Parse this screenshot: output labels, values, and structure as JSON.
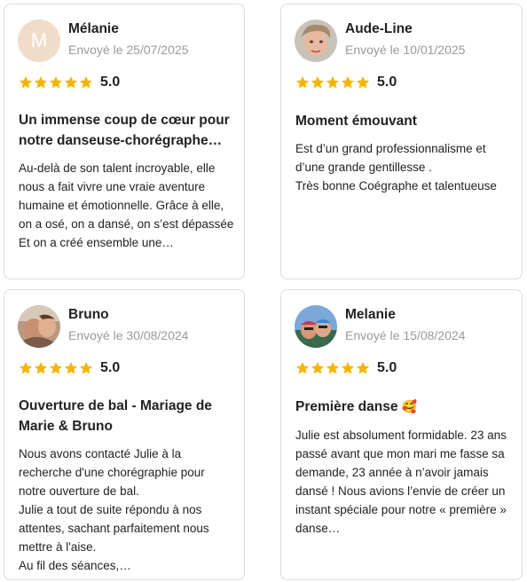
{
  "colors": {
    "star": "#f5b400",
    "border": "#dcdcdc",
    "muted": "#9a9a9a"
  },
  "reviews": [
    {
      "name": "Mélanie",
      "date": "Envoyé le 25/07/2025",
      "avatar_initial": "M",
      "stars": 5,
      "score": "5.0",
      "title": "Un immense coup de cœur pour notre danseuse-chorégraphe…",
      "text": "Au-delà de son talent incroyable, elle nous a fait vivre une vraie aventure humaine et émotionnelle. Grâce à elle, on a osé, on a dansé, on s’est dépassée\nEt on a créé ensemble une…"
    },
    {
      "name": "Aude-Line",
      "date": "Envoyé le 10/01/2025",
      "stars": 5,
      "score": "5.0",
      "title": "Moment émouvant",
      "text": "Est d’un grand professionnalisme et d’une grande gentillesse .\nTrès bonne Coégraphe et talentueuse"
    },
    {
      "name": "Bruno",
      "date": "Envoyé le 30/08/2024",
      "stars": 5,
      "score": "5.0",
      "title": "Ouverture de bal - Mariage de Marie & Bruno",
      "text": "Nous avons contacté Julie à la recherche d'une chorégraphie pour notre ouverture de bal.\nJulie a tout de suite répondu à nos attentes, sachant parfaitement nous mettre à l'aise.\nAu fil des séances,…"
    },
    {
      "name": "Melanie",
      "date": "Envoyé le 15/08/2024",
      "stars": 5,
      "score": "5.0",
      "title": "Première danse",
      "title_emoji": "🥰",
      "text": "Julie est absolument formidable. 23 ans passé avant que mon mari me fasse sa demande, 23 année à n’avoir jamais dansé ! Nous avions l’envie de créer un instant spéciale pour notre « première » danse…"
    }
  ]
}
